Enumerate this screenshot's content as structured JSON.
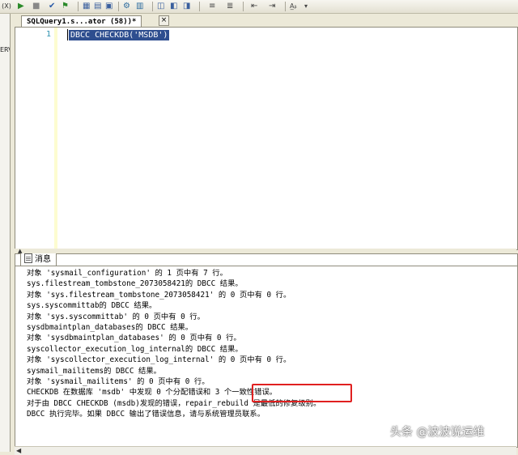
{
  "toolbar": {
    "left_label": "(X)",
    "icons": [
      "execute-icon",
      "stop-icon",
      "parse-check-icon",
      "debug-icon",
      "results-to-grid-icon",
      "results-to-text-icon",
      "results-to-file-icon",
      "display-plan-icon",
      "query-options-icon",
      "include-plan-icon",
      "comment-icon",
      "uncomment-icon",
      "decrease-indent-icon",
      "increase-indent-icon",
      "specify-values-icon"
    ]
  },
  "left_panel": {
    "label": "ERV"
  },
  "editor": {
    "tab_title": "SQLQuery1.s...ator (58))*",
    "close_label": "×",
    "line_number": "1",
    "code": "DBCC CHECKDB('MSDB')"
  },
  "results": {
    "tab_label": "消息",
    "lines": [
      "对象 'sysmail_configuration' 的 1 页中有 7 行。",
      "sys.filestream_tombstone_2073058421的 DBCC 结果。",
      "对象 'sys.filestream_tombstone_2073058421' 的 0 页中有 0 行。",
      "sys.syscommittab的 DBCC 结果。",
      "对象 'sys.syscommittab' 的 0 页中有 0 行。",
      "sysdbmaintplan_databases的 DBCC 结果。",
      "对象 'sysdbmaintplan_databases' 的 0 页中有 0 行。",
      "syscollector_execution_log_internal的 DBCC 结果。",
      "对象 'syscollector_execution_log_internal' 的 0 页中有 0 行。",
      "sysmail_mailitems的 DBCC 结果。",
      "对象 'sysmail_mailitems' 的 0 页中有 0 行。",
      "CHECKDB 在数据库 'msdb' 中发现 0 个分配错误和 3 个一致性错误。",
      "对于由 DBCC CHECKDB (msdb)发现的错误，repair_rebuild 是最低的修复级别。",
      "DBCC 执行完毕。如果 DBCC 输出了错误信息，请与系统管理员联系。"
    ]
  },
  "watermark": "头条 @波波说运维",
  "colors": {
    "selection": "#2e4e8f",
    "highlight_box": "#e02020",
    "line_number": "#2b91af"
  }
}
